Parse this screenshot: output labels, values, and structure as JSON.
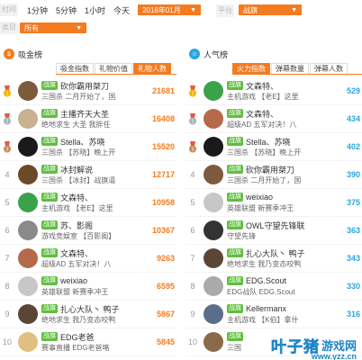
{
  "filters": {
    "time_label": "时间",
    "time_options": [
      "1分钟",
      "5分钟",
      "1小时",
      "今天"
    ],
    "month_value": "2018年01月",
    "platform_label": "平台",
    "platform_value": "战旗",
    "category_label": "类目",
    "category_value": "所有"
  },
  "left_panel": {
    "title": "吸金榜",
    "icon": "dollar-icon",
    "tabs": [
      "吸金指数",
      "礼物价值",
      "礼物人数"
    ],
    "active_tab": 2,
    "rows": [
      {
        "rank": "1",
        "platform": "战旗",
        "name": "砍你霸用桀刀",
        "desc": "三国杀 二月开始了，国",
        "value": "21681",
        "avatar_bg": "#7c5a3b"
      },
      {
        "rank": "2",
        "platform": "战旗",
        "name": "主播齐天大圣",
        "desc": "绝地求生 大圣 我胖任",
        "value": "16408",
        "avatar_bg": "#c9b08f"
      },
      {
        "rank": "3",
        "platform": "战旗",
        "name": "Stella、苏晓",
        "desc": "三国杀 【苏晓】晚上开",
        "value": "15520",
        "avatar_bg": "#1a1a1a"
      },
      {
        "rank": "4",
        "platform": "战旗",
        "name": "冰封解说",
        "desc": "三国杀 【冰封】战旗逼",
        "value": "12717",
        "avatar_bg": "#6b4a2a"
      },
      {
        "rank": "5",
        "platform": "战旗",
        "name": "文森特、",
        "desc": "主机游戏 【老E】这里",
        "value": "10958",
        "avatar_bg": "#3aa34a"
      },
      {
        "rank": "6",
        "platform": "战旗",
        "name": "苏、影阁",
        "desc": "游戏竞娱室 【百影阁】",
        "value": "10367",
        "avatar_bg": "#8a8a8a"
      },
      {
        "rank": "7",
        "platform": "战旗",
        "name": "文森特、",
        "desc": "超级AD 五军对决！八",
        "value": "9263",
        "avatar_bg": "#b56a4a"
      },
      {
        "rank": "8",
        "platform": "战旗",
        "name": "weixiao",
        "desc": "英雄联盟 新赛季冲王",
        "value": "6595",
        "avatar_bg": "#c7c7c7"
      },
      {
        "rank": "9",
        "platform": "战旗",
        "name": "扎心大队丶 鸭子",
        "desc": "绝地求生 我乃变态咬鸭",
        "value": "5867",
        "avatar_bg": "#5b4636"
      },
      {
        "rank": "10",
        "platform": "战旗",
        "name": "EDG老爸",
        "desc": "赛事直播 EDG老爸咯",
        "value": "5845",
        "avatar_bg": "#e0c080"
      }
    ]
  },
  "right_panel": {
    "title": "人气榜",
    "icon": "people-icon",
    "tabs": [
      "火力指数",
      "弹幕数量",
      "弹幕人数"
    ],
    "active_tab": 0,
    "rows": [
      {
        "rank": "1",
        "platform": "战旗",
        "name": "文森特、",
        "desc": "主机游戏 【老E】这里",
        "value": "529",
        "avatar_bg": "#3aa34a"
      },
      {
        "rank": "2",
        "platform": "战旗",
        "name": "文森特、",
        "desc": "超级AD 五军对决！八",
        "value": "434",
        "avatar_bg": "#b56a4a"
      },
      {
        "rank": "3",
        "platform": "战旗",
        "name": "Stella、苏晓",
        "desc": "三国杀 【苏晓】晚上开",
        "value": "402",
        "avatar_bg": "#1a1a1a"
      },
      {
        "rank": "4",
        "platform": "战旗",
        "name": "砍你霸用桀刀",
        "desc": "三国杀 二月开始了，国",
        "value": "390",
        "avatar_bg": "#7c5a3b"
      },
      {
        "rank": "5",
        "platform": "战旗",
        "name": "weixiao",
        "desc": "英雄联盟 新赛季冲王",
        "value": "375",
        "avatar_bg": "#c7c7c7"
      },
      {
        "rank": "6",
        "platform": "战旗",
        "name": "OWL守望先锋联",
        "desc": "守望先锋",
        "value": "363",
        "avatar_bg": "#333333"
      },
      {
        "rank": "7",
        "platform": "战旗",
        "name": "扎心大队丶 鸭子",
        "desc": "绝地求生 我乃变态咬鸭",
        "value": "343",
        "avatar_bg": "#5b4636"
      },
      {
        "rank": "8",
        "platform": "战旗",
        "name": "EDG.Scout",
        "desc": "EDG战队 EDG.Scout",
        "value": "330",
        "avatar_bg": "#aaaaaa"
      },
      {
        "rank": "9",
        "platform": "战旗",
        "name": "Kellermanx",
        "desc": "主机游戏 【K伯】拿什",
        "value": "316",
        "avatar_bg": "#5a6e8a"
      },
      {
        "rank": "10",
        "platform": "战旗",
        "name": "",
        "desc": "三国",
        "value": "",
        "avatar_bg": "#8a6a4a"
      }
    ]
  },
  "watermark": {
    "brand": "叶子猪",
    "suffix": "游戏网",
    "url": "www.yzz.cn"
  },
  "colors": {
    "accent": "#f47b20",
    "right_value": "#2ca6e0",
    "platform_badge": "#5fbf3f",
    "left_icon": "#f47b20",
    "right_icon": "#2ca6e0"
  }
}
